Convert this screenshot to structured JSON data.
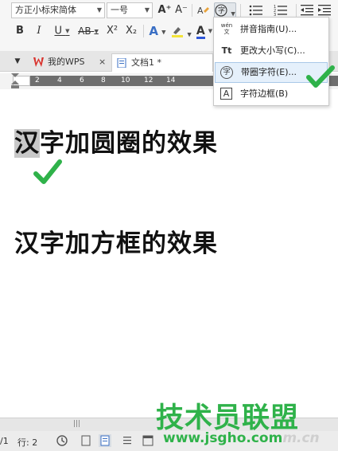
{
  "toolbar": {
    "font_name": "方正小标宋简体",
    "font_size": "一号",
    "grow_font": "A⁺",
    "shrink_font": "A⁻",
    "bold": "B",
    "italic": "I",
    "underline": "U",
    "strikethrough": "AB",
    "superscript": "X²",
    "subscript": "X₂",
    "enclose_char_glyph": "字",
    "font_color_letter": "A",
    "text_effect_letter": "A"
  },
  "tabs": [
    {
      "label": "我的WPS",
      "close": "×"
    },
    {
      "label": "文档1 *"
    }
  ],
  "ruler": {
    "marks": [
      "2",
      "4",
      "6",
      "8",
      "10",
      "12",
      "14"
    ]
  },
  "document": {
    "line1_first_char": "汉",
    "line1_rest": "字加圆圈的效果",
    "line2": "汉字加方框的效果"
  },
  "menu": {
    "items": [
      {
        "icon_text": "wén文",
        "label": "拼音指南(U)..."
      },
      {
        "icon_text": "Tt",
        "label": "更改大小写(C)..."
      },
      {
        "icon_text": "字",
        "label": "带圈字符(E)..."
      },
      {
        "icon_text": "A",
        "label": "字符边框(B)"
      }
    ]
  },
  "status": {
    "page": "/1",
    "line": "行: 2"
  },
  "watermark": {
    "cn": "技术员联盟",
    "url": "www.jsgho.com",
    "tail": "m.cn"
  },
  "colors": {
    "accent_green": "#2fb24a",
    "ruler_band": "#6e6e6e",
    "menu_hover": "#e5f0fb"
  }
}
